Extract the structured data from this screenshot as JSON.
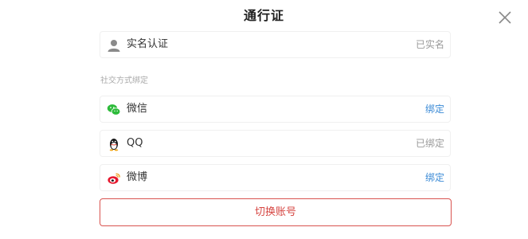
{
  "header": {
    "title": "通行证"
  },
  "identity": {
    "label": "实名认证",
    "status": "已实名",
    "icon": "user-icon"
  },
  "social": {
    "section_title": "社交方式绑定",
    "items": [
      {
        "label": "微信",
        "status": "绑定",
        "status_color": "#3a8ad6",
        "icon": "wechat-icon"
      },
      {
        "label": "QQ",
        "status": "已绑定",
        "status_color": "#9a9a9a",
        "icon": "qq-icon"
      },
      {
        "label": "微博",
        "status": "绑定",
        "status_color": "#3a8ad6",
        "icon": "weibo-icon"
      }
    ]
  },
  "footer": {
    "switch_label": "切换账号",
    "accent": "#d64541"
  }
}
